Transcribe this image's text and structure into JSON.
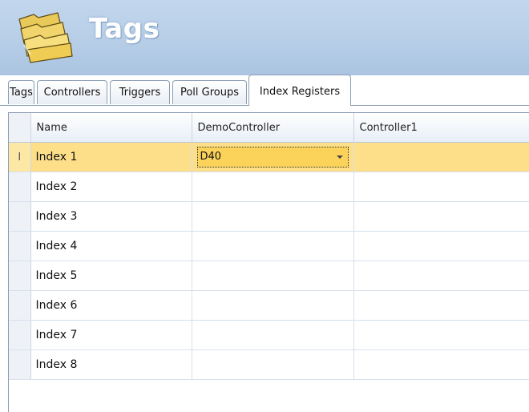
{
  "header": {
    "title": "Tags",
    "icon": "folder-stack-icon"
  },
  "tabs": [
    {
      "label": "Tags",
      "active": false
    },
    {
      "label": "Controllers",
      "active": false
    },
    {
      "label": "Triggers",
      "active": false
    },
    {
      "label": "Poll Groups",
      "active": false
    },
    {
      "label": "Index Registers",
      "active": true
    }
  ],
  "grid": {
    "columns": [
      "Name",
      "DemoController",
      "Controller1"
    ],
    "rows": [
      {
        "name": "Index 1",
        "demo": "D40",
        "controller1": "",
        "selected": true
      },
      {
        "name": "Index 2",
        "demo": "",
        "controller1": ""
      },
      {
        "name": "Index 3",
        "demo": "",
        "controller1": ""
      },
      {
        "name": "Index 4",
        "demo": "",
        "controller1": ""
      },
      {
        "name": "Index 5",
        "demo": "",
        "controller1": ""
      },
      {
        "name": "Index 6",
        "demo": "",
        "controller1": ""
      },
      {
        "name": "Index 7",
        "demo": "",
        "controller1": ""
      },
      {
        "name": "Index 8",
        "demo": "",
        "controller1": ""
      }
    ],
    "current_row_indicator": "I"
  },
  "colors": {
    "header_bg": "#b7cee7",
    "selected_row": "#fddf8a",
    "editor_bg": "#fbd35a",
    "border": "#8b9db3"
  }
}
